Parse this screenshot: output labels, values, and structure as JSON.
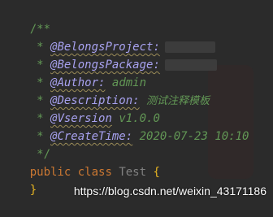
{
  "editor": {
    "comment_open": "/**",
    "lines": [
      {
        "tag": "@BelongsProject:",
        "value": "",
        "redacted": true
      },
      {
        "tag": "@BelongsPackage:",
        "value": "",
        "redacted": true
      },
      {
        "tag": "@Author:",
        "value": "admin",
        "redacted": false
      },
      {
        "tag": "@Description:",
        "value": "测试注释模板",
        "redacted": false
      },
      {
        "tag": "@Vsersion",
        "value": "v1.0.0",
        "redacted": false
      },
      {
        "tag": "@CreateTime:",
        "value": "2020-07-23 10:10",
        "redacted": false
      }
    ],
    "comment_close": "*/",
    "class_decl": {
      "keyword1": "public",
      "keyword2": "class",
      "name": "Test",
      "open_brace": "{",
      "close_brace": "}"
    }
  },
  "watermark": {
    "text": "https://blog.csdn.net/weixin_43171186"
  },
  "colors": {
    "background": "#2b2b2b",
    "javadoc": "#629755",
    "javadoc_tag": "#a8a2f0",
    "keyword": "#cc7832",
    "class_name": "#808080",
    "brace": "#e6b422"
  }
}
